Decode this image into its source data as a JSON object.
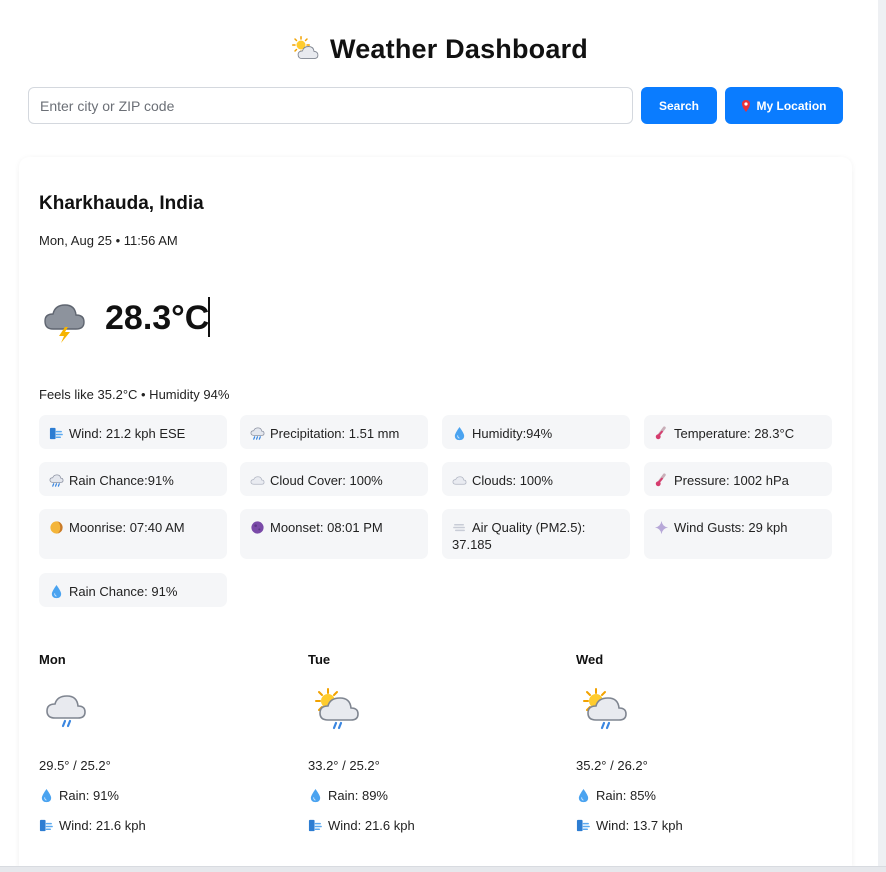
{
  "header": {
    "title": "Weather Dashboard",
    "icon": "sun-behind-cloud-icon"
  },
  "search": {
    "placeholder": "Enter city or ZIP code",
    "value": "",
    "search_label": "Search",
    "location_label": "My Location",
    "location_icon": "pin-icon"
  },
  "colors": {
    "accent": "#0a7cff",
    "tile_bg": "#f5f6f8"
  },
  "current": {
    "city": "Kharkhauda, India",
    "datetime": "Mon, Aug 25 • 11:56 AM",
    "icon": "thunder-cloud-icon",
    "temp": "28.3°C",
    "feels": "Feels like 35.2°C • Humidity 94%"
  },
  "details": [
    {
      "icon": "wind-icon",
      "text": "Wind: 21.2 kph ESE"
    },
    {
      "icon": "rain-cloud-icon",
      "text": "Precipitation: 1.51 mm"
    },
    {
      "icon": "droplet-icon",
      "text": "Humidity:94%"
    },
    {
      "icon": "thermometer-icon",
      "text": "Temperature: 28.3°C"
    },
    {
      "icon": "rain-cloud-icon",
      "text": "Rain Chance:91%"
    },
    {
      "icon": "cloud-icon",
      "text": "Cloud Cover: 100%"
    },
    {
      "icon": "cloud-icon",
      "text": "Clouds: 100%"
    },
    {
      "icon": "thermometer-icon",
      "text": "Pressure: 1002 hPa"
    },
    {
      "icon": "moonrise-icon",
      "text": "Moonrise: 07:40 AM"
    },
    {
      "icon": "moonset-icon",
      "text": "Moonset: 08:01 PM"
    },
    {
      "icon": "fog-icon",
      "text": "Air Quality (PM2.5): 37.185"
    },
    {
      "icon": "sparkle-icon",
      "text": "Wind Gusts: 29 kph"
    },
    {
      "icon": "droplet-icon",
      "text": "Rain Chance: 91%"
    }
  ],
  "forecast": [
    {
      "day": "Mon",
      "icon": "rain-cloud-icon",
      "temps": "29.5° / 25.2°",
      "rain": "Rain: 91%",
      "wind": "Wind: 21.6 kph"
    },
    {
      "day": "Tue",
      "icon": "sun-rain-cloud-icon",
      "temps": "33.2° / 25.2°",
      "rain": "Rain: 89%",
      "wind": "Wind: 21.6 kph"
    },
    {
      "day": "Wed",
      "icon": "sun-rain-cloud-icon",
      "temps": "35.2° / 26.2°",
      "rain": "Rain: 85%",
      "wind": "Wind: 13.7 kph"
    }
  ]
}
